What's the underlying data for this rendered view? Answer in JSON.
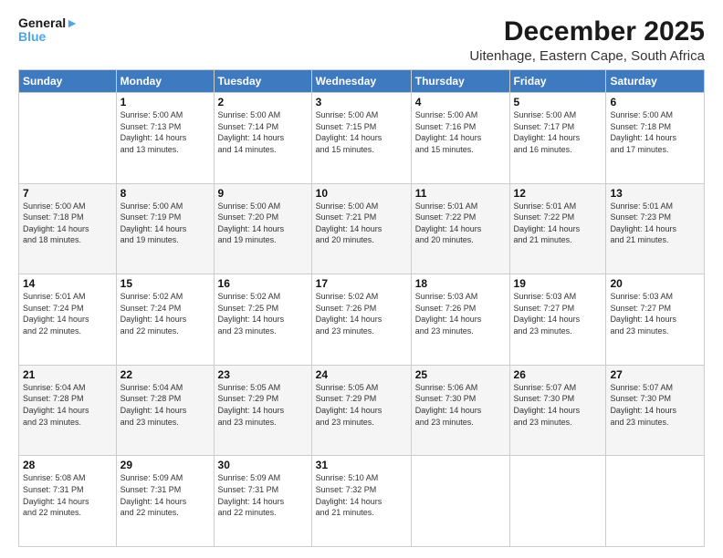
{
  "logo": {
    "line1": "General",
    "line2": "Blue"
  },
  "title": "December 2025",
  "subtitle": "Uitenhage, Eastern Cape, South Africa",
  "headers": [
    "Sunday",
    "Monday",
    "Tuesday",
    "Wednesday",
    "Thursday",
    "Friday",
    "Saturday"
  ],
  "weeks": [
    [
      {
        "day": "",
        "info": ""
      },
      {
        "day": "1",
        "info": "Sunrise: 5:00 AM\nSunset: 7:13 PM\nDaylight: 14 hours\nand 13 minutes."
      },
      {
        "day": "2",
        "info": "Sunrise: 5:00 AM\nSunset: 7:14 PM\nDaylight: 14 hours\nand 14 minutes."
      },
      {
        "day": "3",
        "info": "Sunrise: 5:00 AM\nSunset: 7:15 PM\nDaylight: 14 hours\nand 15 minutes."
      },
      {
        "day": "4",
        "info": "Sunrise: 5:00 AM\nSunset: 7:16 PM\nDaylight: 14 hours\nand 15 minutes."
      },
      {
        "day": "5",
        "info": "Sunrise: 5:00 AM\nSunset: 7:17 PM\nDaylight: 14 hours\nand 16 minutes."
      },
      {
        "day": "6",
        "info": "Sunrise: 5:00 AM\nSunset: 7:18 PM\nDaylight: 14 hours\nand 17 minutes."
      }
    ],
    [
      {
        "day": "7",
        "info": "Sunrise: 5:00 AM\nSunset: 7:18 PM\nDaylight: 14 hours\nand 18 minutes."
      },
      {
        "day": "8",
        "info": "Sunrise: 5:00 AM\nSunset: 7:19 PM\nDaylight: 14 hours\nand 19 minutes."
      },
      {
        "day": "9",
        "info": "Sunrise: 5:00 AM\nSunset: 7:20 PM\nDaylight: 14 hours\nand 19 minutes."
      },
      {
        "day": "10",
        "info": "Sunrise: 5:00 AM\nSunset: 7:21 PM\nDaylight: 14 hours\nand 20 minutes."
      },
      {
        "day": "11",
        "info": "Sunrise: 5:01 AM\nSunset: 7:22 PM\nDaylight: 14 hours\nand 20 minutes."
      },
      {
        "day": "12",
        "info": "Sunrise: 5:01 AM\nSunset: 7:22 PM\nDaylight: 14 hours\nand 21 minutes."
      },
      {
        "day": "13",
        "info": "Sunrise: 5:01 AM\nSunset: 7:23 PM\nDaylight: 14 hours\nand 21 minutes."
      }
    ],
    [
      {
        "day": "14",
        "info": "Sunrise: 5:01 AM\nSunset: 7:24 PM\nDaylight: 14 hours\nand 22 minutes."
      },
      {
        "day": "15",
        "info": "Sunrise: 5:02 AM\nSunset: 7:24 PM\nDaylight: 14 hours\nand 22 minutes."
      },
      {
        "day": "16",
        "info": "Sunrise: 5:02 AM\nSunset: 7:25 PM\nDaylight: 14 hours\nand 23 minutes."
      },
      {
        "day": "17",
        "info": "Sunrise: 5:02 AM\nSunset: 7:26 PM\nDaylight: 14 hours\nand 23 minutes."
      },
      {
        "day": "18",
        "info": "Sunrise: 5:03 AM\nSunset: 7:26 PM\nDaylight: 14 hours\nand 23 minutes."
      },
      {
        "day": "19",
        "info": "Sunrise: 5:03 AM\nSunset: 7:27 PM\nDaylight: 14 hours\nand 23 minutes."
      },
      {
        "day": "20",
        "info": "Sunrise: 5:03 AM\nSunset: 7:27 PM\nDaylight: 14 hours\nand 23 minutes."
      }
    ],
    [
      {
        "day": "21",
        "info": "Sunrise: 5:04 AM\nSunset: 7:28 PM\nDaylight: 14 hours\nand 23 minutes."
      },
      {
        "day": "22",
        "info": "Sunrise: 5:04 AM\nSunset: 7:28 PM\nDaylight: 14 hours\nand 23 minutes."
      },
      {
        "day": "23",
        "info": "Sunrise: 5:05 AM\nSunset: 7:29 PM\nDaylight: 14 hours\nand 23 minutes."
      },
      {
        "day": "24",
        "info": "Sunrise: 5:05 AM\nSunset: 7:29 PM\nDaylight: 14 hours\nand 23 minutes."
      },
      {
        "day": "25",
        "info": "Sunrise: 5:06 AM\nSunset: 7:30 PM\nDaylight: 14 hours\nand 23 minutes."
      },
      {
        "day": "26",
        "info": "Sunrise: 5:07 AM\nSunset: 7:30 PM\nDaylight: 14 hours\nand 23 minutes."
      },
      {
        "day": "27",
        "info": "Sunrise: 5:07 AM\nSunset: 7:30 PM\nDaylight: 14 hours\nand 23 minutes."
      }
    ],
    [
      {
        "day": "28",
        "info": "Sunrise: 5:08 AM\nSunset: 7:31 PM\nDaylight: 14 hours\nand 22 minutes."
      },
      {
        "day": "29",
        "info": "Sunrise: 5:09 AM\nSunset: 7:31 PM\nDaylight: 14 hours\nand 22 minutes."
      },
      {
        "day": "30",
        "info": "Sunrise: 5:09 AM\nSunset: 7:31 PM\nDaylight: 14 hours\nand 22 minutes."
      },
      {
        "day": "31",
        "info": "Sunrise: 5:10 AM\nSunset: 7:32 PM\nDaylight: 14 hours\nand 21 minutes."
      },
      {
        "day": "",
        "info": ""
      },
      {
        "day": "",
        "info": ""
      },
      {
        "day": "",
        "info": ""
      }
    ]
  ]
}
